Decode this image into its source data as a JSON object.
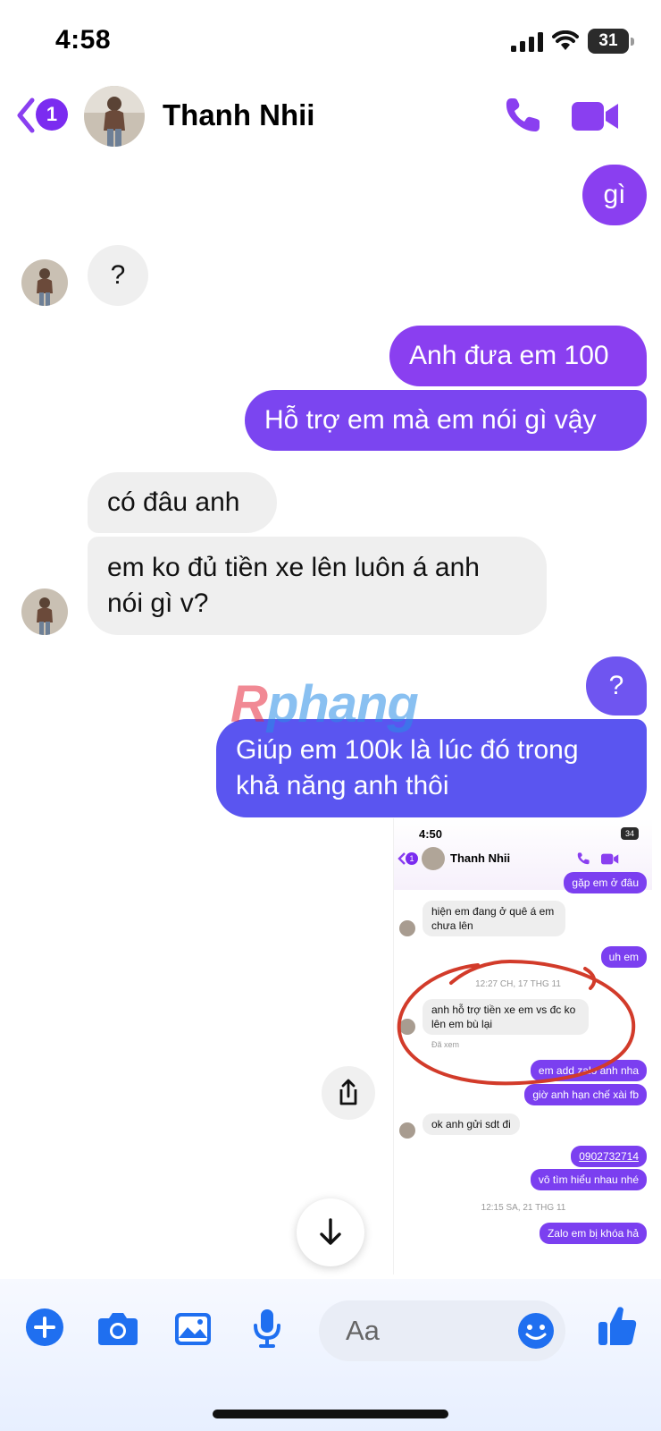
{
  "status_bar": {
    "time": "4:58",
    "battery": "31"
  },
  "header": {
    "unread_count": "1",
    "contact_name": "Thanh Nhii"
  },
  "messages": [
    {
      "dir": "out",
      "text": "gì"
    },
    {
      "dir": "in",
      "text": "?"
    },
    {
      "dir": "out",
      "text": "Anh đưa em 100"
    },
    {
      "dir": "out",
      "text": "Hỗ trợ em mà em nói gì vậy"
    },
    {
      "dir": "in",
      "text": "có đâu anh"
    },
    {
      "dir": "in",
      "line1": "em ko đủ tiền xe lên luôn á anh",
      "line2": "nói gì v?"
    },
    {
      "dir": "out",
      "text": "?"
    },
    {
      "dir": "out",
      "line1": "Giúp em 100k là lúc đó trong",
      "line2": "khả năng anh thôi"
    }
  ],
  "watermark": {
    "a": "R",
    "b": "phang"
  },
  "shared_screenshot": {
    "time": "4:50",
    "battery": "34",
    "unread_count": "1",
    "contact_name": "Thanh Nhii",
    "items": [
      {
        "dir": "out",
        "text": "gặp em ở đâu"
      },
      {
        "dir": "in",
        "line1": "hiện em đang ở quê á em",
        "line2": "chưa lên"
      },
      {
        "dir": "out",
        "text": "uh em"
      },
      {
        "dir": "date",
        "text": "12:27 CH, 17 THG 11"
      },
      {
        "dir": "in",
        "line1": "anh hỗ trợ tiền xe em vs đc ko",
        "line2": "lên em bù lại"
      },
      {
        "dir": "status",
        "text": "Đã xem"
      },
      {
        "dir": "out",
        "text": "em add zalo anh nha"
      },
      {
        "dir": "out",
        "text": "giờ anh hạn chế xài fb"
      },
      {
        "dir": "in",
        "text": "ok anh gửi sdt đi"
      },
      {
        "dir": "out",
        "text": "0902732714"
      },
      {
        "dir": "out",
        "text": "vô tìm hiểu nhau nhé"
      },
      {
        "dir": "date",
        "text": "12:15 SA, 21 THG 11"
      },
      {
        "dir": "out",
        "text": "Zalo em bị khóa hả"
      }
    ]
  },
  "composer": {
    "placeholder": "Aa"
  },
  "colors": {
    "accent": "#8a3ff0",
    "icon_blue": "#1f6ff0",
    "incoming": "#efefef",
    "annotation_red": "#d23b2a"
  },
  "icons": [
    "back-chevron-icon",
    "phone-icon",
    "video-icon",
    "share-icon",
    "arrow-down-icon",
    "plus-icon",
    "camera-icon",
    "image-icon",
    "mic-icon",
    "emoji-icon",
    "thumbs-up-icon"
  ]
}
